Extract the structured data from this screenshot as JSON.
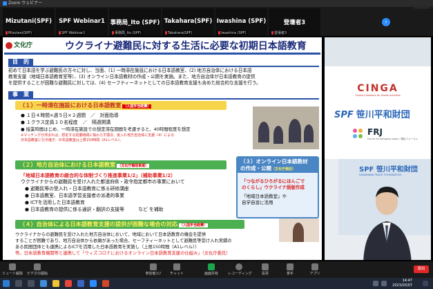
{
  "window": {
    "title": "Zoom ウェビナー",
    "view_label": "表示"
  },
  "participants": [
    {
      "name": "Mizutani(SPF)",
      "sub": "Mizutani(SPF)"
    },
    {
      "name": "SPF Webinar1",
      "sub": "SPF Webinar1"
    },
    {
      "name": "事務局_Ito (SPF)",
      "sub": "事務局_Ito (SPF)"
    },
    {
      "name": "Takahara(SPF)",
      "sub": "Takahara(SPF)"
    },
    {
      "name": "Iwashina (SPF)",
      "sub": "Iwashina (SPF)"
    },
    {
      "name": "登壇者3",
      "sub": "登壇者3"
    }
  ],
  "slide": {
    "logo": "文化庁",
    "title": "ウクライナ避難民に対する生活に必要な初期日本語教育",
    "purpose_label": "目　的",
    "purpose_lines": [
      "初めて日本語を学ぶ避難民の方々に対し、当面、(1) 一時滞在施設における日本語教室、(2) 地方自治体における日本語",
      "教育支援（地域日本語教育室等）、(3) オンライン日本語教材の作成・公開を実施。また、地方自治体が日本語教育の提供",
      "を提供することが困難な避難民に対しては、(4) セーフティーネットとしての日本語教育支援も含めた総合的な支援を行う。"
    ],
    "business_label": "事　業",
    "s1": {
      "title": "（１）一時滞在施設における日本語教室",
      "tag": "（入国手当経費）",
      "bullets": [
        "１日４時間×週５日×２週間　／　対面指導",
        "１クラス定員１０名程度　／　隔週開講",
        "授業時間はじめ、一時滞在施設での想定滞在期間を考慮すると、40時間程度を想定"
      ],
      "notes": [
        "※マッチングが済まれば、想定する授業時間に係わらず順次、受入れ地方自治体に支援（4）による",
        "日本語教室に引き継ぎ、日本語教室は上限150時間（A1レベル）。"
      ]
    },
    "s2": {
      "title": "（２）地方自治体における日本語教室",
      "tag": "（文化庁補助事業）",
      "highlight": "「地域日本語教育の総合的な体制づくり推進事業1/2」（補助事業1/2）",
      "intro": "ウクライナからの避難民を受け入れた都道府県・政令指定都市の事業において",
      "bullets": [
        "避難民等の受入れ・日本語教育に係る研修講座",
        "日本語教室、日本語学習支援者の派遣的事業",
        "ICTを活用した日本語教育",
        "日本語教育の提供に係る通訳・翻訳の支援等　　　など を補助"
      ]
    },
    "s3": {
      "title": "（３）オンライン日本語教材",
      "title2": "の作成・公開",
      "tag": "（文化庁委託）",
      "red1": "「つながるひろがるにほんごで",
      "red2": "のくらし」ウクライナ語版作成",
      "lines": [
        "「地域日本語教室」や",
        "自学自習に活用"
      ]
    },
    "s4": {
      "title": "（４）自治体による日本語教育支援の提供が困難な場合の対応",
      "tag": "（入国手当経費）",
      "lines": [
        "ウクライナからの避難民を受け入れた地方自治体において、地域において日本語教育の機会を提供",
        "することが困難であり、地方自治体から依頼があった場合、セーフティーネットとして避難民等受け入れ実績の",
        "ある民間団体とも連携によるICTを活用した日本語教育を実施し（上限150時間（A1レベル））",
        "等。日本語教育機関等と連携して「ウィズコロナにおけるオンライン日本語教育支援の仕組み」（文化庁委託）"
      ]
    }
  },
  "sidebar": {
    "cinga": "CINGA",
    "cinga_sub": "Citizen's Network for Global Activities",
    "spf_mark": "SPF",
    "spf_name": "笹川平和財団",
    "frj": "FRJ",
    "frj_sub": "Forum for Refugees Japan / 難民フォーラム",
    "backdrop_text": "SPF 笹川平和財団",
    "backdrop_sub": "SASAKAWA PEACE FOUNDATION"
  },
  "controls": {
    "left": [
      {
        "label": "ミュート解除"
      },
      {
        "label": "ビデオの開始"
      }
    ],
    "center": [
      {
        "label": "参加者",
        "count": "157"
      },
      {
        "label": "チャット"
      },
      {
        "label": "画面共有"
      },
      {
        "label": "レコーディング"
      },
      {
        "label": "投票"
      },
      {
        "label": "挙手"
      },
      {
        "label": "アプリ"
      }
    ],
    "end_label": "退出"
  },
  "taskbar": {
    "time": "14:47",
    "date": "2023/03/07"
  },
  "colors": {
    "zoom_blue": "#2d8cff",
    "end_red": "#e02828",
    "slide_blue": "#2a52a8",
    "green": "#4caf50"
  }
}
